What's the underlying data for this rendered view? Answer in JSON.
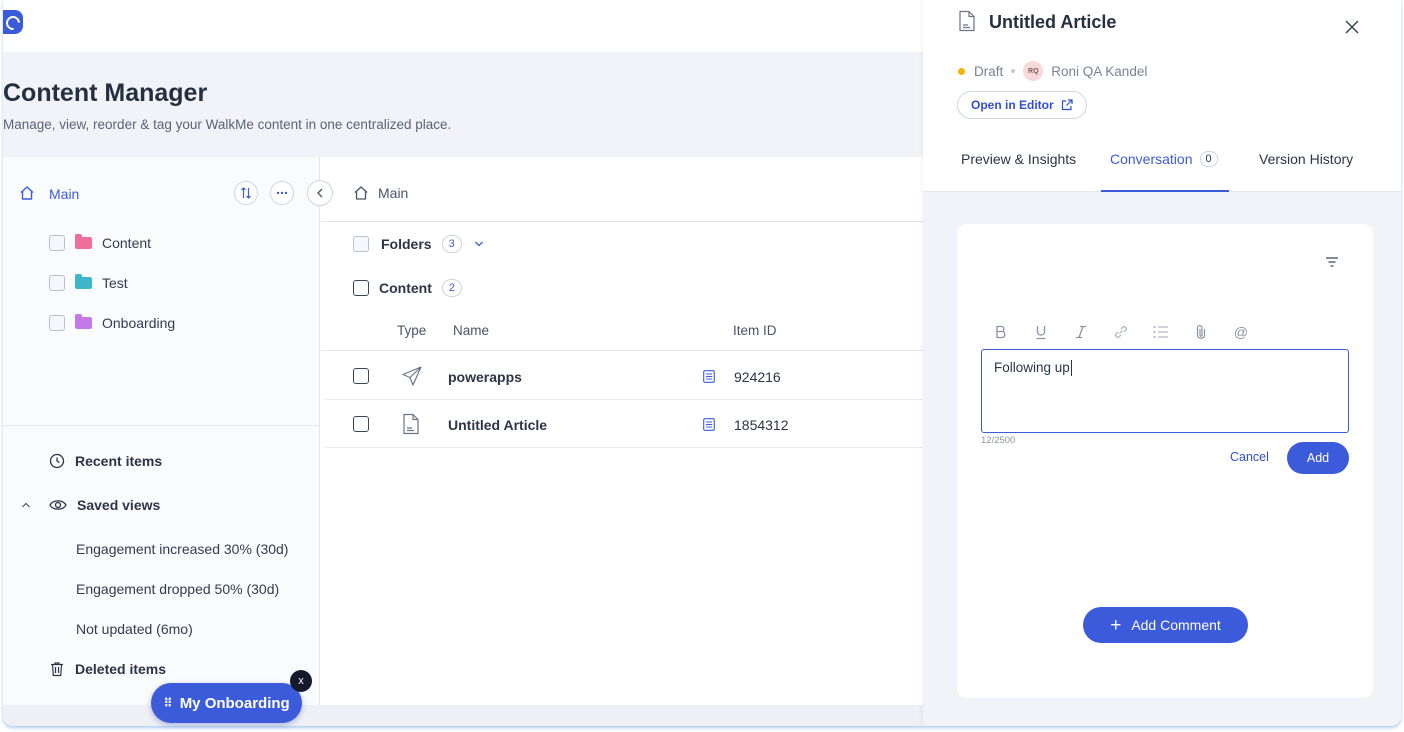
{
  "page": {
    "title": "Content Manager",
    "subtitle": "Manage, view, reorder & tag your WalkMe content in one centralized place."
  },
  "sidebar": {
    "root_label": "Main",
    "folders": [
      {
        "label": "Content",
        "color": "#ef6f9a"
      },
      {
        "label": "Test",
        "color": "#3fb6c7"
      },
      {
        "label": "Onboarding",
        "color": "#c27be6"
      }
    ],
    "recent_label": "Recent items",
    "saved_views_label": "Saved views",
    "saved_views": [
      "Engagement increased 30% (30d)",
      "Engagement dropped 50% (30d)",
      "Not updated (6mo)"
    ],
    "deleted_label": "Deleted items"
  },
  "main": {
    "breadcrumb": "Main",
    "folders_label": "Folders",
    "folders_count": "3",
    "content_label": "Content",
    "content_count": "2",
    "columns": {
      "type": "Type",
      "name": "Name",
      "item_id": "Item ID"
    },
    "rows": [
      {
        "type_icon": "paper-plane-icon",
        "name": "powerapps",
        "item_id": "924216"
      },
      {
        "type_icon": "article-icon",
        "name": "Untitled Article",
        "item_id": "1854312"
      }
    ]
  },
  "drawer": {
    "title": "Untitled Article",
    "status": "Draft",
    "owner_initials": "RQ",
    "owner_name": "Roni QA Kandel",
    "open_editor_label": "Open in Editor",
    "tabs": {
      "preview": "Preview & Insights",
      "conversation": "Conversation",
      "conversation_count": "0",
      "history": "Version History"
    },
    "comment_text": "Following up",
    "char_count": "12/2500",
    "cancel_label": "Cancel",
    "add_label": "Add",
    "add_comment_label": "Add Comment"
  },
  "onboarding": {
    "label": "My Onboarding",
    "close_label": "x"
  },
  "colors": {
    "accent": "#3b5bdb",
    "draft": "#f4b400"
  }
}
